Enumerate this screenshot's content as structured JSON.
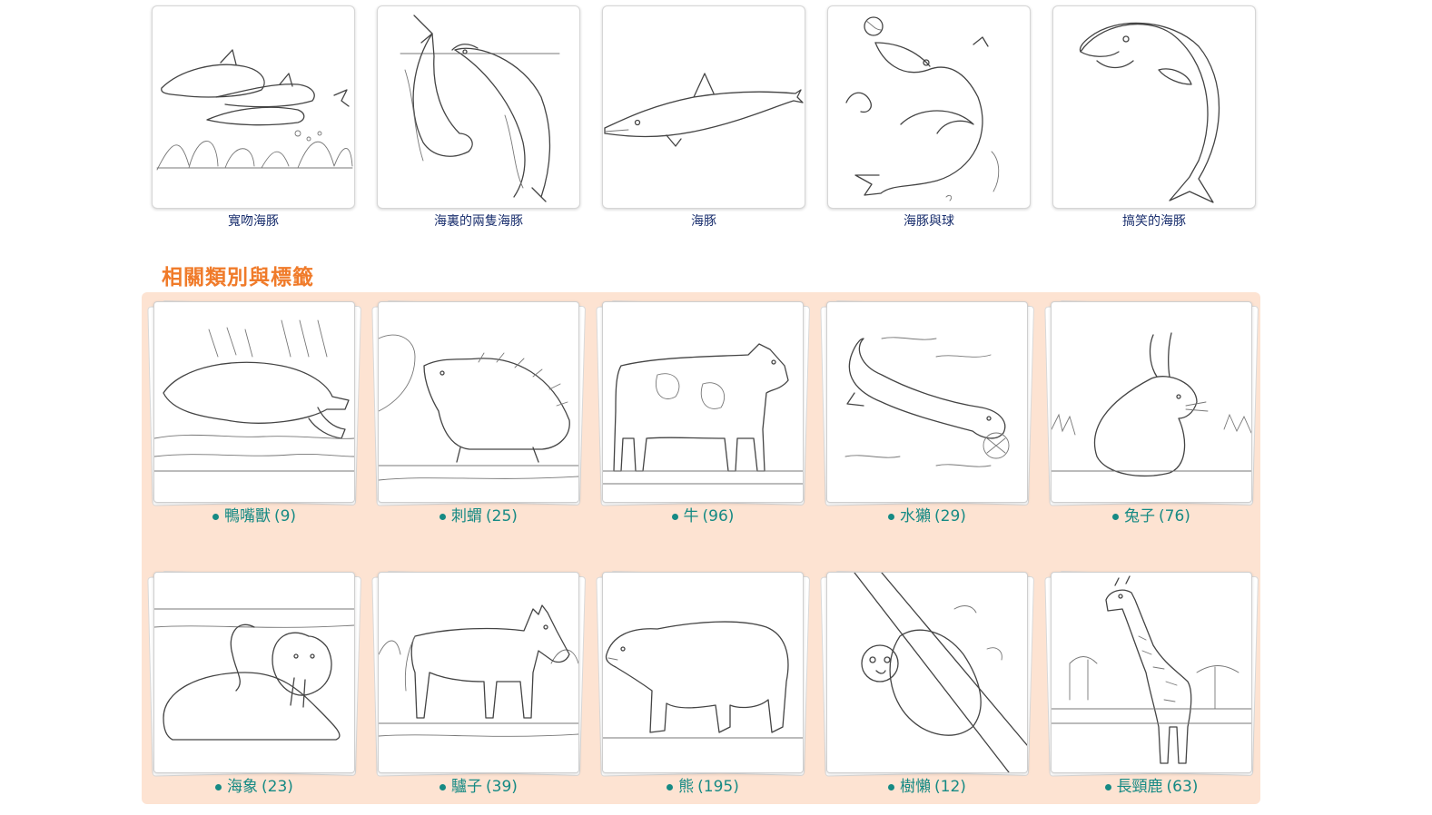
{
  "top_items": [
    {
      "caption": "寬吻海豚",
      "icon": "dolphins-reef-drawing"
    },
    {
      "caption": "海裏的兩隻海豚",
      "icon": "two-dolphins-drawing"
    },
    {
      "caption": "海豚",
      "icon": "dolphin-drawing"
    },
    {
      "caption": "海豚與球",
      "icon": "dolphin-ball-drawing"
    },
    {
      "caption": "搞笑的海豚",
      "icon": "funny-dolphin-drawing"
    }
  ],
  "related": {
    "title": "相關類別與標籤",
    "categories": [
      {
        "name": "鴨嘴獸",
        "count": "(9)",
        "icon": "platypus-drawing"
      },
      {
        "name": "刺蝟",
        "count": "(25)",
        "icon": "hedgehog-drawing"
      },
      {
        "name": "牛",
        "count": "(96)",
        "icon": "cow-drawing"
      },
      {
        "name": "水獺",
        "count": "(29)",
        "icon": "otter-drawing"
      },
      {
        "name": "兔子",
        "count": "(76)",
        "icon": "rabbit-drawing"
      },
      {
        "name": "海象",
        "count": "(23)",
        "icon": "walrus-drawing"
      },
      {
        "name": "驢子",
        "count": "(39)",
        "icon": "donkey-drawing"
      },
      {
        "name": "熊",
        "count": "(195)",
        "icon": "bear-drawing"
      },
      {
        "name": "樹懶",
        "count": "(12)",
        "icon": "sloth-drawing"
      },
      {
        "name": "長頸鹿",
        "count": "(63)",
        "icon": "giraffe-drawing"
      }
    ]
  },
  "colors": {
    "caption_text": "#1a2f6e",
    "section_title": "#f07b2a",
    "panel_background": "#fde3d2",
    "category_link": "#168a84"
  }
}
